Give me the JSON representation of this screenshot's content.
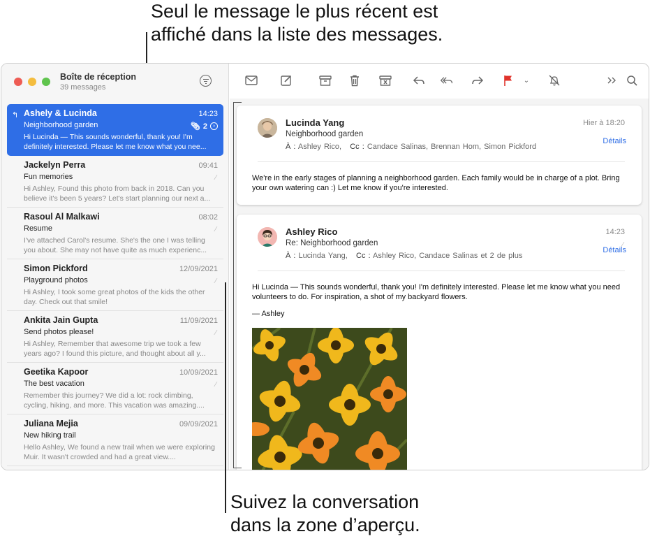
{
  "callouts": {
    "top_line1": "Seul le message le plus récent est",
    "top_line2": "affiché dans la liste des messages.",
    "bottom_line1": "Suivez la conversation",
    "bottom_line2": "dans la zone d’aperçu."
  },
  "sidebar": {
    "title": "Boîte de réception",
    "count": "39 messages",
    "messages": [
      {
        "sender": "Ashely & Lucinda",
        "date": "14:23",
        "subject": "Neighborhood garden",
        "preview": "Hi Lucinda — This sounds wonderful, thank you! I'm definitely interested. Please let me know what you nee...",
        "thread_count": "2",
        "selected": true
      },
      {
        "sender": "Jackelyn Perra",
        "date": "09:41",
        "subject": "Fun memories",
        "preview": "Hi Ashley, Found this photo from back in 2018. Can you believe it's been 5 years? Let's start planning our next a..."
      },
      {
        "sender": "Rasoul Al Malkawi",
        "date": "08:02",
        "subject": "Resume",
        "preview": "I've attached Carol's resume. She's the one I was telling you about. She may not have quite as much experienc..."
      },
      {
        "sender": "Simon Pickford",
        "date": "12/09/2021",
        "subject": "Playground photos",
        "preview": "Hi Ashley, I took some great photos of the kids the other day. Check out that smile!"
      },
      {
        "sender": "Ankita Jain Gupta",
        "date": "11/09/2021",
        "subject": "Send photos please!",
        "preview": "Hi Ashley, Remember that awesome trip we took a few years ago? I found this picture, and thought about all y..."
      },
      {
        "sender": "Geetika Kapoor",
        "date": "10/09/2021",
        "subject": "The best vacation",
        "preview": "Remember this journey? We did a lot: rock climbing, cycling, hiking, and more. This vacation was amazing...."
      },
      {
        "sender": "Juliana Mejia",
        "date": "09/09/2021",
        "subject": "New hiking trail",
        "preview": "Hello Ashley, We found a new trail when we were exploring Muir. It wasn't crowded and had a great view...."
      }
    ]
  },
  "conversation": [
    {
      "from": "Lucinda Yang",
      "date": "Hier à 18:20",
      "subject": "Neighborhood garden",
      "to_label": "À :",
      "to": "Ashley Rico,",
      "cc_label": "Cc :",
      "cc": "Candace Salinas,   Brennan Hom,   Simon Pickford",
      "details": "Détails",
      "body": "We're in the early stages of planning a neighborhood garden. Each family would be in charge of a plot. Bring your own watering can :) Let me know if you're interested."
    },
    {
      "from": "Ashley Rico",
      "date": "14:23",
      "subject": "Re: Neighborhood garden",
      "to_label": "À :",
      "to": "Lucinda Yang,",
      "cc_label": "Cc :",
      "cc": "Ashley Rico,   Candace Salinas     et 2 de plus",
      "details": "Détails",
      "body": "Hi Lucinda — This sounds wonderful, thank you! I'm definitely interested. Please let me know what you need volunteers to do. For inspiration, a shot of my backyard flowers.",
      "signature": "— Ashley"
    }
  ],
  "colors": {
    "accent": "#2f6ee6",
    "flag": "#e0332b"
  }
}
